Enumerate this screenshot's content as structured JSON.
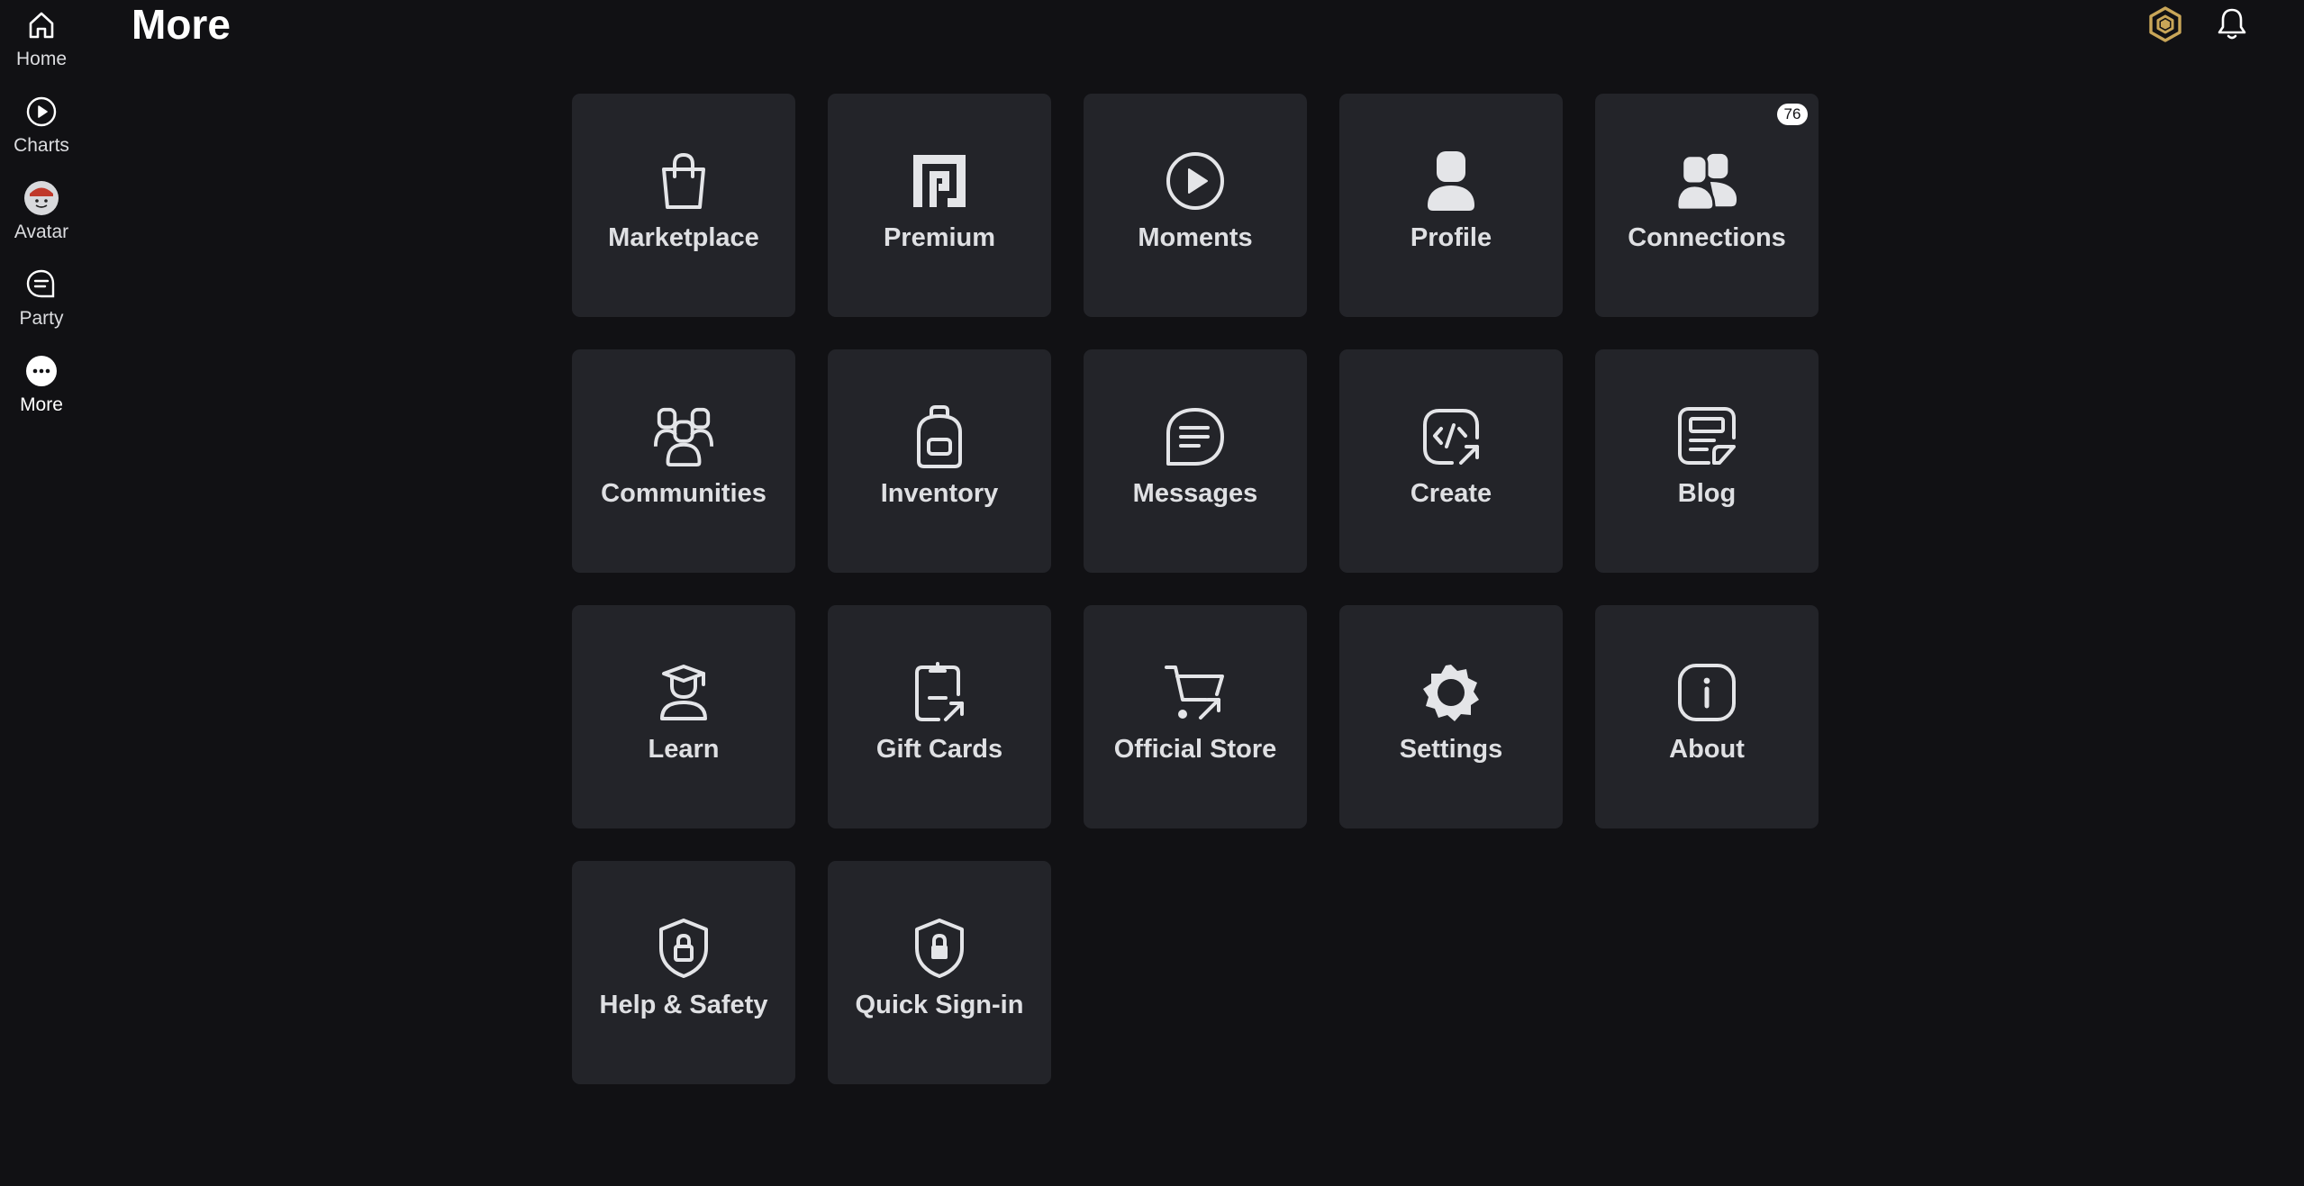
{
  "header": {
    "title": "More",
    "actions": [
      {
        "icon": "robux-icon",
        "color": "#c9a658"
      },
      {
        "icon": "bell-icon",
        "color": "#ffffff"
      }
    ]
  },
  "sidebar": {
    "items": [
      {
        "label": "Home",
        "icon": "home-icon",
        "active": false
      },
      {
        "label": "Charts",
        "icon": "play-circle-icon",
        "active": false
      },
      {
        "label": "Avatar",
        "icon": "avatar-icon",
        "active": false
      },
      {
        "label": "Party",
        "icon": "chat-icon",
        "active": false
      },
      {
        "label": "More",
        "icon": "more-icon",
        "active": true
      }
    ]
  },
  "tiles": [
    {
      "label": "Marketplace",
      "icon": "shopping-bag-icon"
    },
    {
      "label": "Premium",
      "icon": "premium-icon"
    },
    {
      "label": "Moments",
      "icon": "play-circle-icon"
    },
    {
      "label": "Profile",
      "icon": "person-icon"
    },
    {
      "label": "Connections",
      "icon": "people-icon",
      "badge": "76"
    },
    {
      "label": "Communities",
      "icon": "group-icon"
    },
    {
      "label": "Inventory",
      "icon": "backpack-icon"
    },
    {
      "label": "Messages",
      "icon": "message-icon"
    },
    {
      "label": "Create",
      "icon": "code-icon"
    },
    {
      "label": "Blog",
      "icon": "blog-icon"
    },
    {
      "label": "Learn",
      "icon": "graduation-icon"
    },
    {
      "label": "Gift Cards",
      "icon": "gift-card-icon"
    },
    {
      "label": "Official Store",
      "icon": "cart-icon"
    },
    {
      "label": "Settings",
      "icon": "gear-icon"
    },
    {
      "label": "About",
      "icon": "info-icon"
    },
    {
      "label": "Help & Safety",
      "icon": "shield-lock-icon"
    },
    {
      "label": "Quick Sign-in",
      "icon": "shield-lock-solid-icon"
    }
  ],
  "colors": {
    "background": "#111114",
    "tile": "#232429",
    "text": "#dfe0e3",
    "robux": "#c9a658"
  }
}
